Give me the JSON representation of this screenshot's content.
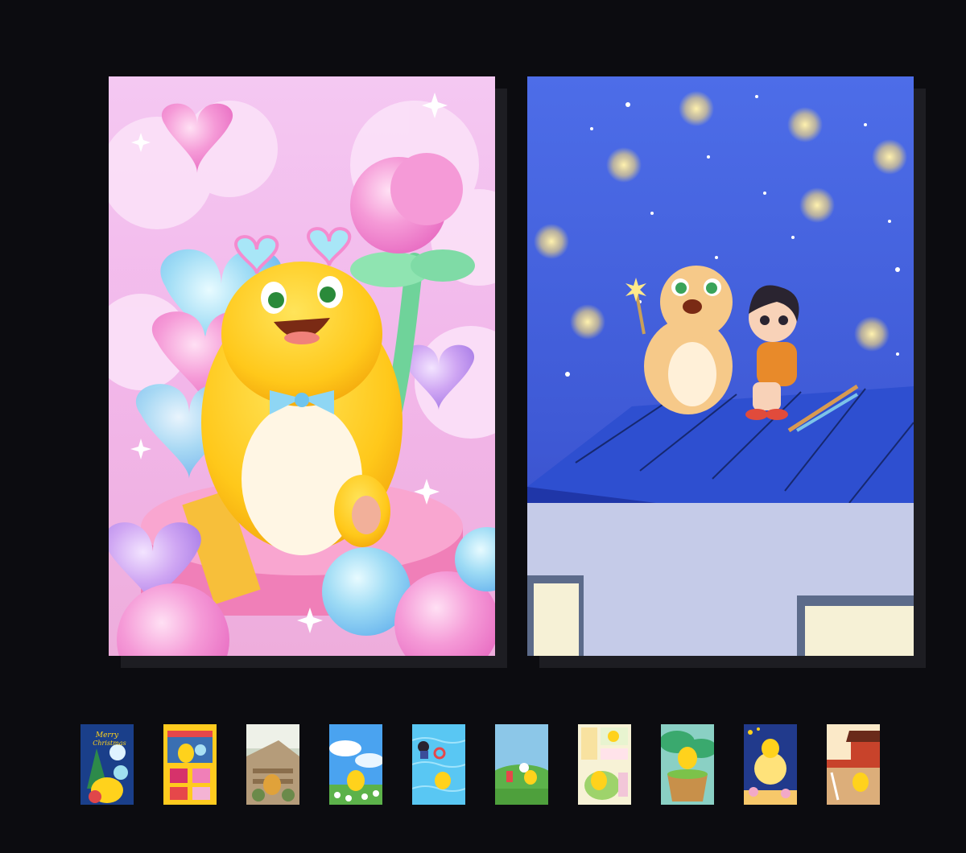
{
  "gallery": {
    "main_cards": [
      {
        "name": "birthday-balloons-illustration",
        "theme_color": "#f6c6ee"
      },
      {
        "name": "rooftop-stars-illustration",
        "theme_color": "#4b6ae3"
      }
    ],
    "thumbnails": [
      {
        "name": "thumb-merry-christmas",
        "caption_line1": "Merry",
        "caption_line2": "Christmas",
        "bg": "#1a3f8a",
        "accent": "#ffd21c"
      },
      {
        "name": "thumb-market-stall",
        "bg": "#ffcb1e",
        "accent": "#d6326b"
      },
      {
        "name": "thumb-street-stairs",
        "bg": "#cfd8c8",
        "accent": "#e0a23a"
      },
      {
        "name": "thumb-sky-flowers",
        "bg": "#4aa3f0",
        "accent": "#ffd21c"
      },
      {
        "name": "thumb-swimming-pool",
        "bg": "#59c7f3",
        "accent": "#ffd21c"
      },
      {
        "name": "thumb-grass-field",
        "bg": "#8cc7e8",
        "accent": "#5cb24a"
      },
      {
        "name": "thumb-comic-panels",
        "bg": "#f7f2d6",
        "accent": "#9ed36b"
      },
      {
        "name": "thumb-green-basket",
        "bg": "#3aa96e",
        "accent": "#ffd21c"
      },
      {
        "name": "thumb-moon-night",
        "bg": "#213a8c",
        "accent": "#ffd21c"
      },
      {
        "name": "thumb-palace-gate",
        "bg": "#dcae7a",
        "accent": "#c8432b"
      }
    ]
  }
}
